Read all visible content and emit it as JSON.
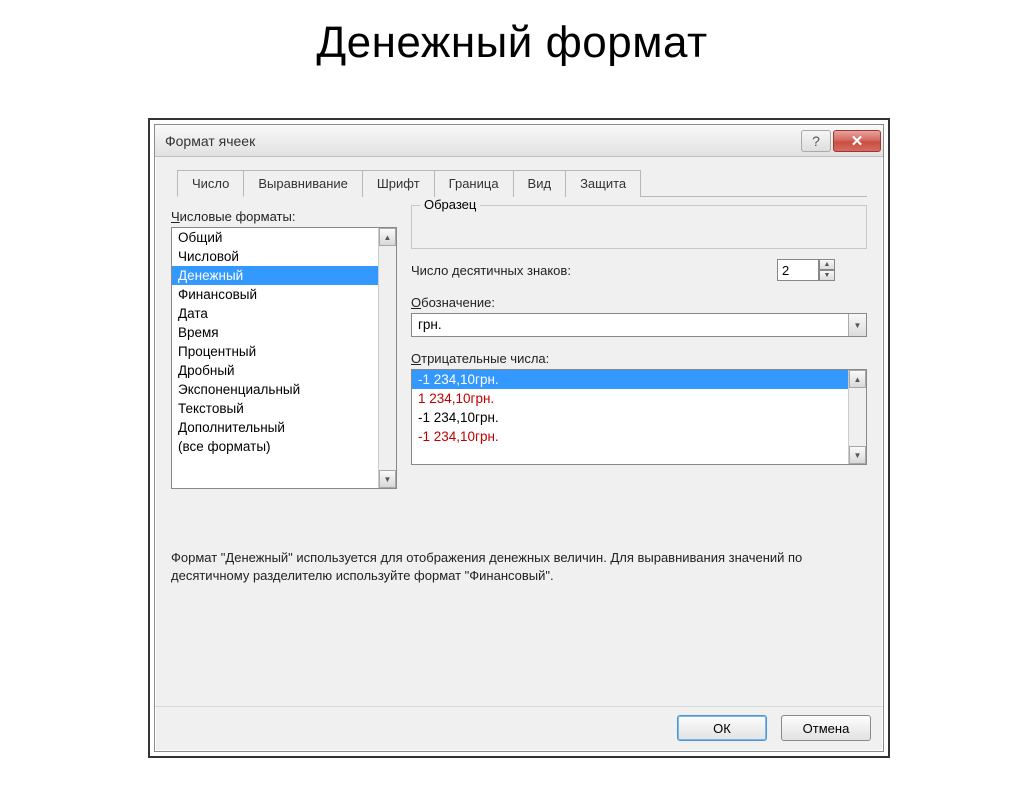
{
  "page": {
    "title": "Денежный формат"
  },
  "window": {
    "title": "Формат ячеек",
    "help_icon": "?",
    "close_icon": "✕"
  },
  "tabs": {
    "items": [
      {
        "label": "Число",
        "active": true
      },
      {
        "label": "Выравнивание"
      },
      {
        "label": "Шрифт"
      },
      {
        "label": "Граница"
      },
      {
        "label": "Вид"
      },
      {
        "label": "Защита"
      }
    ]
  },
  "formats": {
    "label_underline": "Ч",
    "label_rest": "исловые форматы:",
    "items": [
      "Общий",
      "Числовой",
      "Денежный",
      "Финансовый",
      "Дата",
      "Время",
      "Процентный",
      "Дробный",
      "Экспоненциальный",
      "Текстовый",
      "Дополнительный",
      "(все форматы)"
    ],
    "selected_index": 2
  },
  "sample": {
    "legend": "Образец"
  },
  "decimals": {
    "label": "Число десятичных знаков:",
    "value": "2"
  },
  "symbol": {
    "label_underline": "О",
    "label_rest": "бозначение:",
    "value": "грн."
  },
  "negative": {
    "label_underline": "О",
    "label_rest": "трицательные числа:",
    "items": [
      {
        "text": "-1 234,10грн.",
        "selected": true,
        "red": false
      },
      {
        "text": "1 234,10грн.",
        "selected": false,
        "red": true
      },
      {
        "text": "-1 234,10грн.",
        "selected": false,
        "red": false
      },
      {
        "text": "-1 234,10грн.",
        "selected": false,
        "red": true
      }
    ]
  },
  "description": "Формат \"Денежный\" используется для отображения денежных величин. Для выравнивания значений по десятичному разделителю используйте формат \"Финансовый\".",
  "buttons": {
    "ok": "ОК",
    "cancel": "Отмена"
  }
}
